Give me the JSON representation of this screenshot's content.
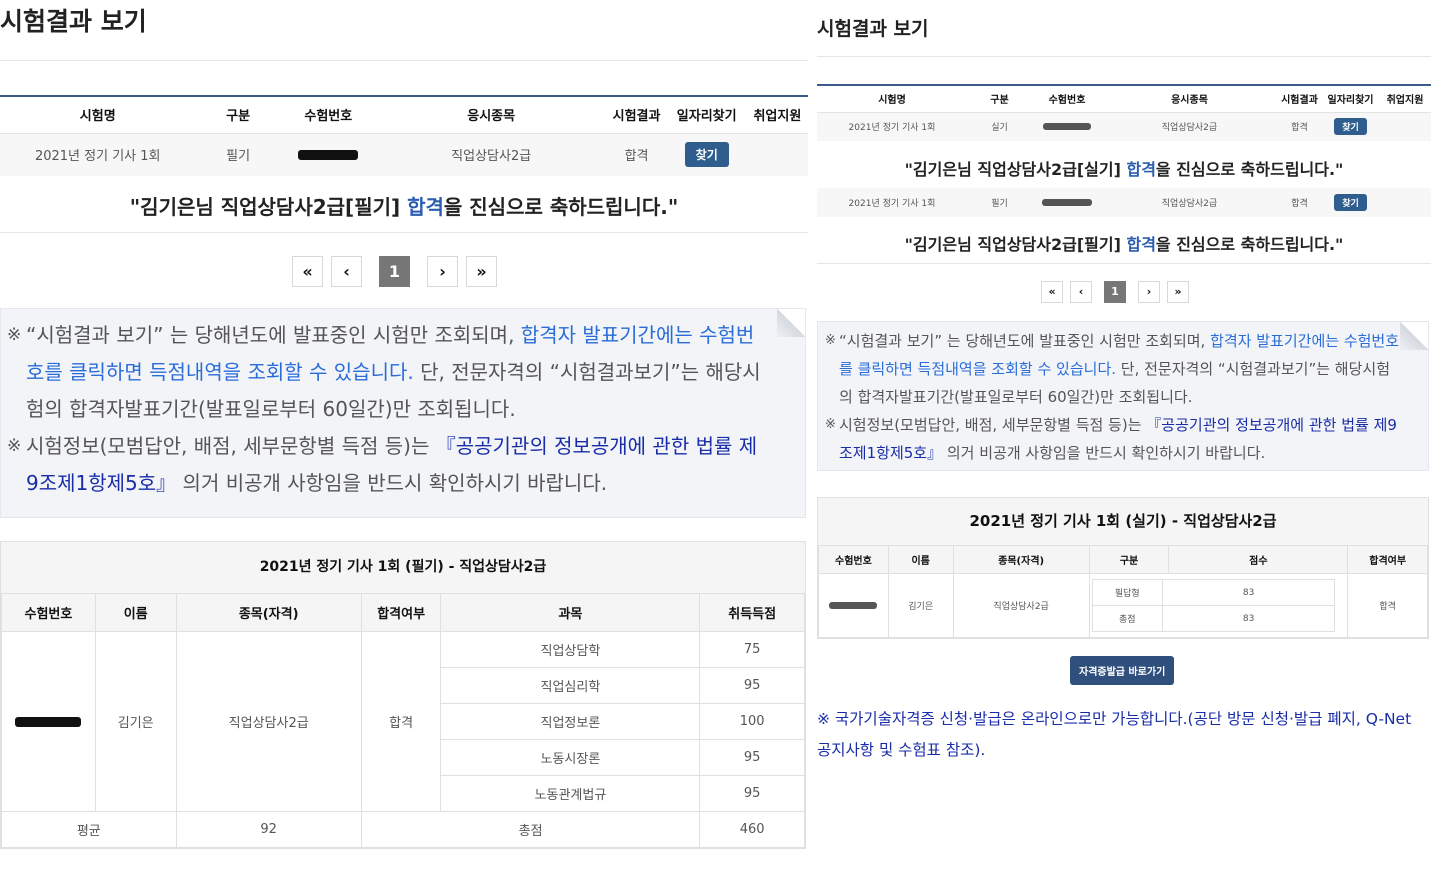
{
  "left": {
    "title": "시험결과 보기",
    "exam_headers": [
      "시험명",
      "구분",
      "수험번호",
      "응시종목",
      "시험결과",
      "일자리찾기",
      "취업지원"
    ],
    "exam_row": {
      "name": "2021년 정기 기사 1회",
      "type": "필기",
      "subject": "직업상담사2급",
      "result": "합격",
      "find_label": "찾기"
    },
    "congrats": {
      "pre": "\"김기은님 직업상담사2급[필기] ",
      "pass": "합격",
      "post": "을 진심으로 축하드립니다.\""
    },
    "pager": {
      "first": "«",
      "prev": "‹",
      "page": "1",
      "next": "›",
      "last": "»"
    },
    "notice": {
      "mark": "※",
      "p1_a": "“시험결과 보기” 는 당해년도에 발표중인 시험만 조회되며, ",
      "p1_hl": "합격자 발표기간에는 수험번호를 클릭하면 득점내역을 조회할 수 있습니다.",
      "p1_b": " 단, 전문자격의 “시험결과보기”는 해당시험의 합격자발표기간(발표일로부터 60일간)만 조회됩니다.",
      "p2_a": "시험정보(모범답안, 배점, 세부문항별 득점 등)는 ",
      "p2_law": "『공공기관의 정보공개에 관한 법률 제9조제1항제5호』",
      "p2_b": " 의거 비공개 사항임을 반드시 확인하시기 바랍니다."
    },
    "score": {
      "heading": "2021년 정기 기사 1회 (필기) - 직업상담사2급",
      "headers": [
        "수험번호",
        "이름",
        "종목(자격)",
        "합격여부",
        "과목",
        "취득득점"
      ],
      "name": "김기은",
      "subject": "직업상담사2급",
      "pass": "합격",
      "rows": [
        {
          "subject": "직업상담학",
          "score": "75"
        },
        {
          "subject": "직업심리학",
          "score": "95"
        },
        {
          "subject": "직업정보론",
          "score": "100"
        },
        {
          "subject": "노동시장론",
          "score": "95"
        },
        {
          "subject": "노동관계법규",
          "score": "95"
        }
      ],
      "avg_label": "평균",
      "avg_value": "92",
      "total_label": "총점",
      "total_value": "460"
    }
  },
  "right": {
    "title": "시험결과 보기",
    "exam_headers": [
      "시험명",
      "구분",
      "수험번호",
      "응시종목",
      "시험결과",
      "일자리찾기",
      "취업지원"
    ],
    "row1": {
      "name": "2021년 정기 기사 1회",
      "type": "실기",
      "subject": "직업상담사2급",
      "result": "합격",
      "find_label": "찾기"
    },
    "congrats1": {
      "pre": "\"김기은님 직업상담사2급[실기] ",
      "pass": "합격",
      "post": "을 진심으로 축하드립니다.\""
    },
    "row2": {
      "name": "2021년 정기 기사 1회",
      "type": "필기",
      "subject": "직업상담사2급",
      "result": "합격",
      "find_label": "찾기"
    },
    "congrats2": {
      "pre": "\"김기은님 직업상담사2급[필기] ",
      "pass": "합격",
      "post": "을 진심으로 축하드립니다.\""
    },
    "pager": {
      "first": "«",
      "prev": "‹",
      "page": "1",
      "next": "›",
      "last": "»"
    },
    "notice": {
      "mark": "※",
      "p1_a": "“시험결과 보기” 는 당해년도에 발표중인 시험만 조회되며, ",
      "p1_hl": "합격자 발표기간에는 수험번호를 클릭하면 득점내역을 조회할 수 있습니다.",
      "p1_b": " 단, 전문자격의 “시험결과보기”는 해당시험의 합격자발표기간(발표일로부터 60일간)만 조회됩니다.",
      "p2_a": "시험정보(모범답안, 배점, 세부문항별 득점 등)는 ",
      "p2_law": "『공공기관의 정보공개에 관한 법률 제9조제1항제5호』",
      "p2_b": " 의거 비공개 사항임을 반드시 확인하시기 바랍니다."
    },
    "score": {
      "heading": "2021년 정기 기사 1회 (실기) - 직업상담사2급",
      "headers": [
        "수험번호",
        "이름",
        "종목(자격)",
        "구분",
        "점수",
        "합격여부"
      ],
      "name": "김기은",
      "subject": "직업상담사2급",
      "rows": [
        {
          "type": "필답형",
          "score": "83"
        },
        {
          "type": "총점",
          "score": "83"
        }
      ],
      "pass": "합격"
    },
    "cert_button": "자격증발급 바로가기",
    "q_notice": "※ 국가기술자격증 신청·발급은 온라인으로만 가능합니다.(공단 방문 신청·발급 폐지, Q-Net 공지사항 및 수험표 참조)."
  }
}
